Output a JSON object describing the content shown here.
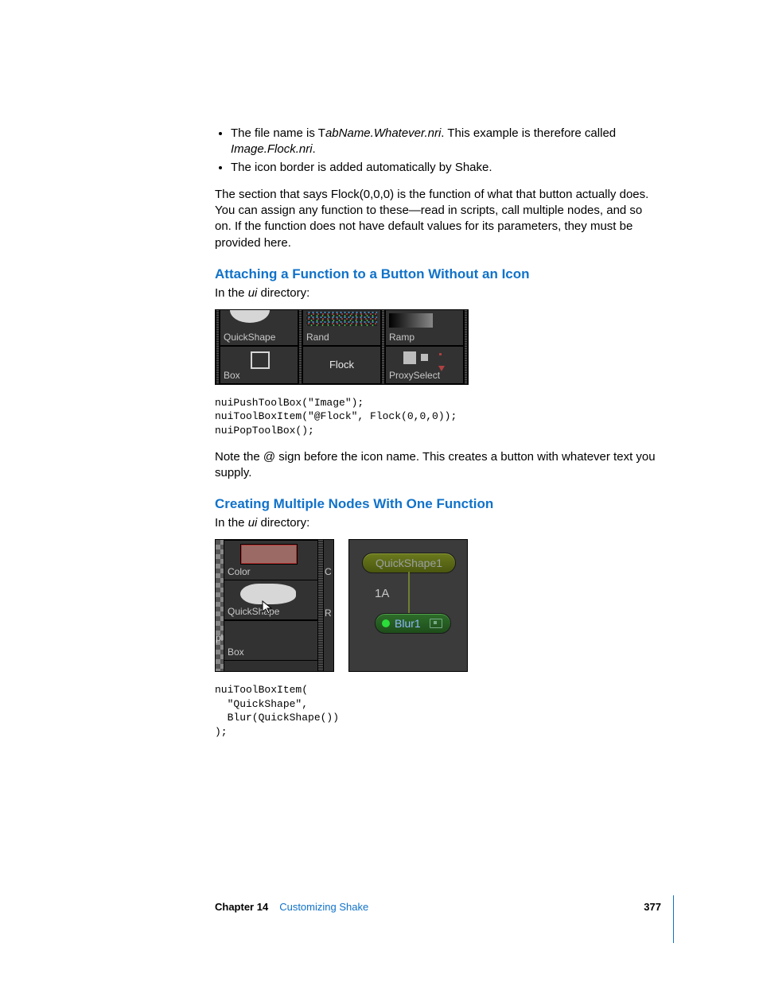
{
  "bullets": [
    {
      "pre": "The file name is T",
      "em1": "abName.Whatever.nri",
      "mid": ". This example is therefore called ",
      "em2": "Image.Flock.nri",
      "post": "."
    },
    {
      "text": "The icon border is added automatically by Shake."
    }
  ],
  "para_flock": "The section that says Flock(0,0,0) is the function of what that button actually does. You can assign any function to these—read in scripts, call multiple nodes, and so on. If the function does not have default values for its parameters, they must be provided here.",
  "h3a": "Attaching a Function to a Button Without an Icon",
  "in_ui_a_pre": "In the ",
  "in_ui_a_em": "ui",
  "in_ui_a_post": " directory:",
  "toolbox1": {
    "quickshape": "QuickShape",
    "rand": "Rand",
    "ramp": "Ramp",
    "box": "Box",
    "flock": "Flock",
    "proxy": "ProxySelect"
  },
  "code1": "nuiPushToolBox(\"Image\");\nnuiToolBoxItem(\"@Flock\", Flock(0,0,0));\nnuiPopToolBox();",
  "para_at": "Note the @ sign before the icon name. This creates a button with whatever text you supply.",
  "h3b": "Creating Multiple Nodes With One Function",
  "in_ui_b_pre": "In the ",
  "in_ui_b_em": "ui",
  "in_ui_b_post": " directory:",
  "fig2": {
    "panelA": {
      "left_stub": "ple",
      "color": "Color",
      "quickshape": "QuickShape",
      "box": "Box",
      "right_c": "C",
      "right_r": "R"
    },
    "panelB": {
      "quickshape1": "QuickShape1",
      "one_a": "1A",
      "blur1": "Blur1"
    }
  },
  "code2": "nuiToolBoxItem(\n  \"QuickShape\",\n  Blur(QuickShape())\n);",
  "footer": {
    "chapter": "Chapter 14",
    "title": "Customizing Shake",
    "page": "377"
  }
}
